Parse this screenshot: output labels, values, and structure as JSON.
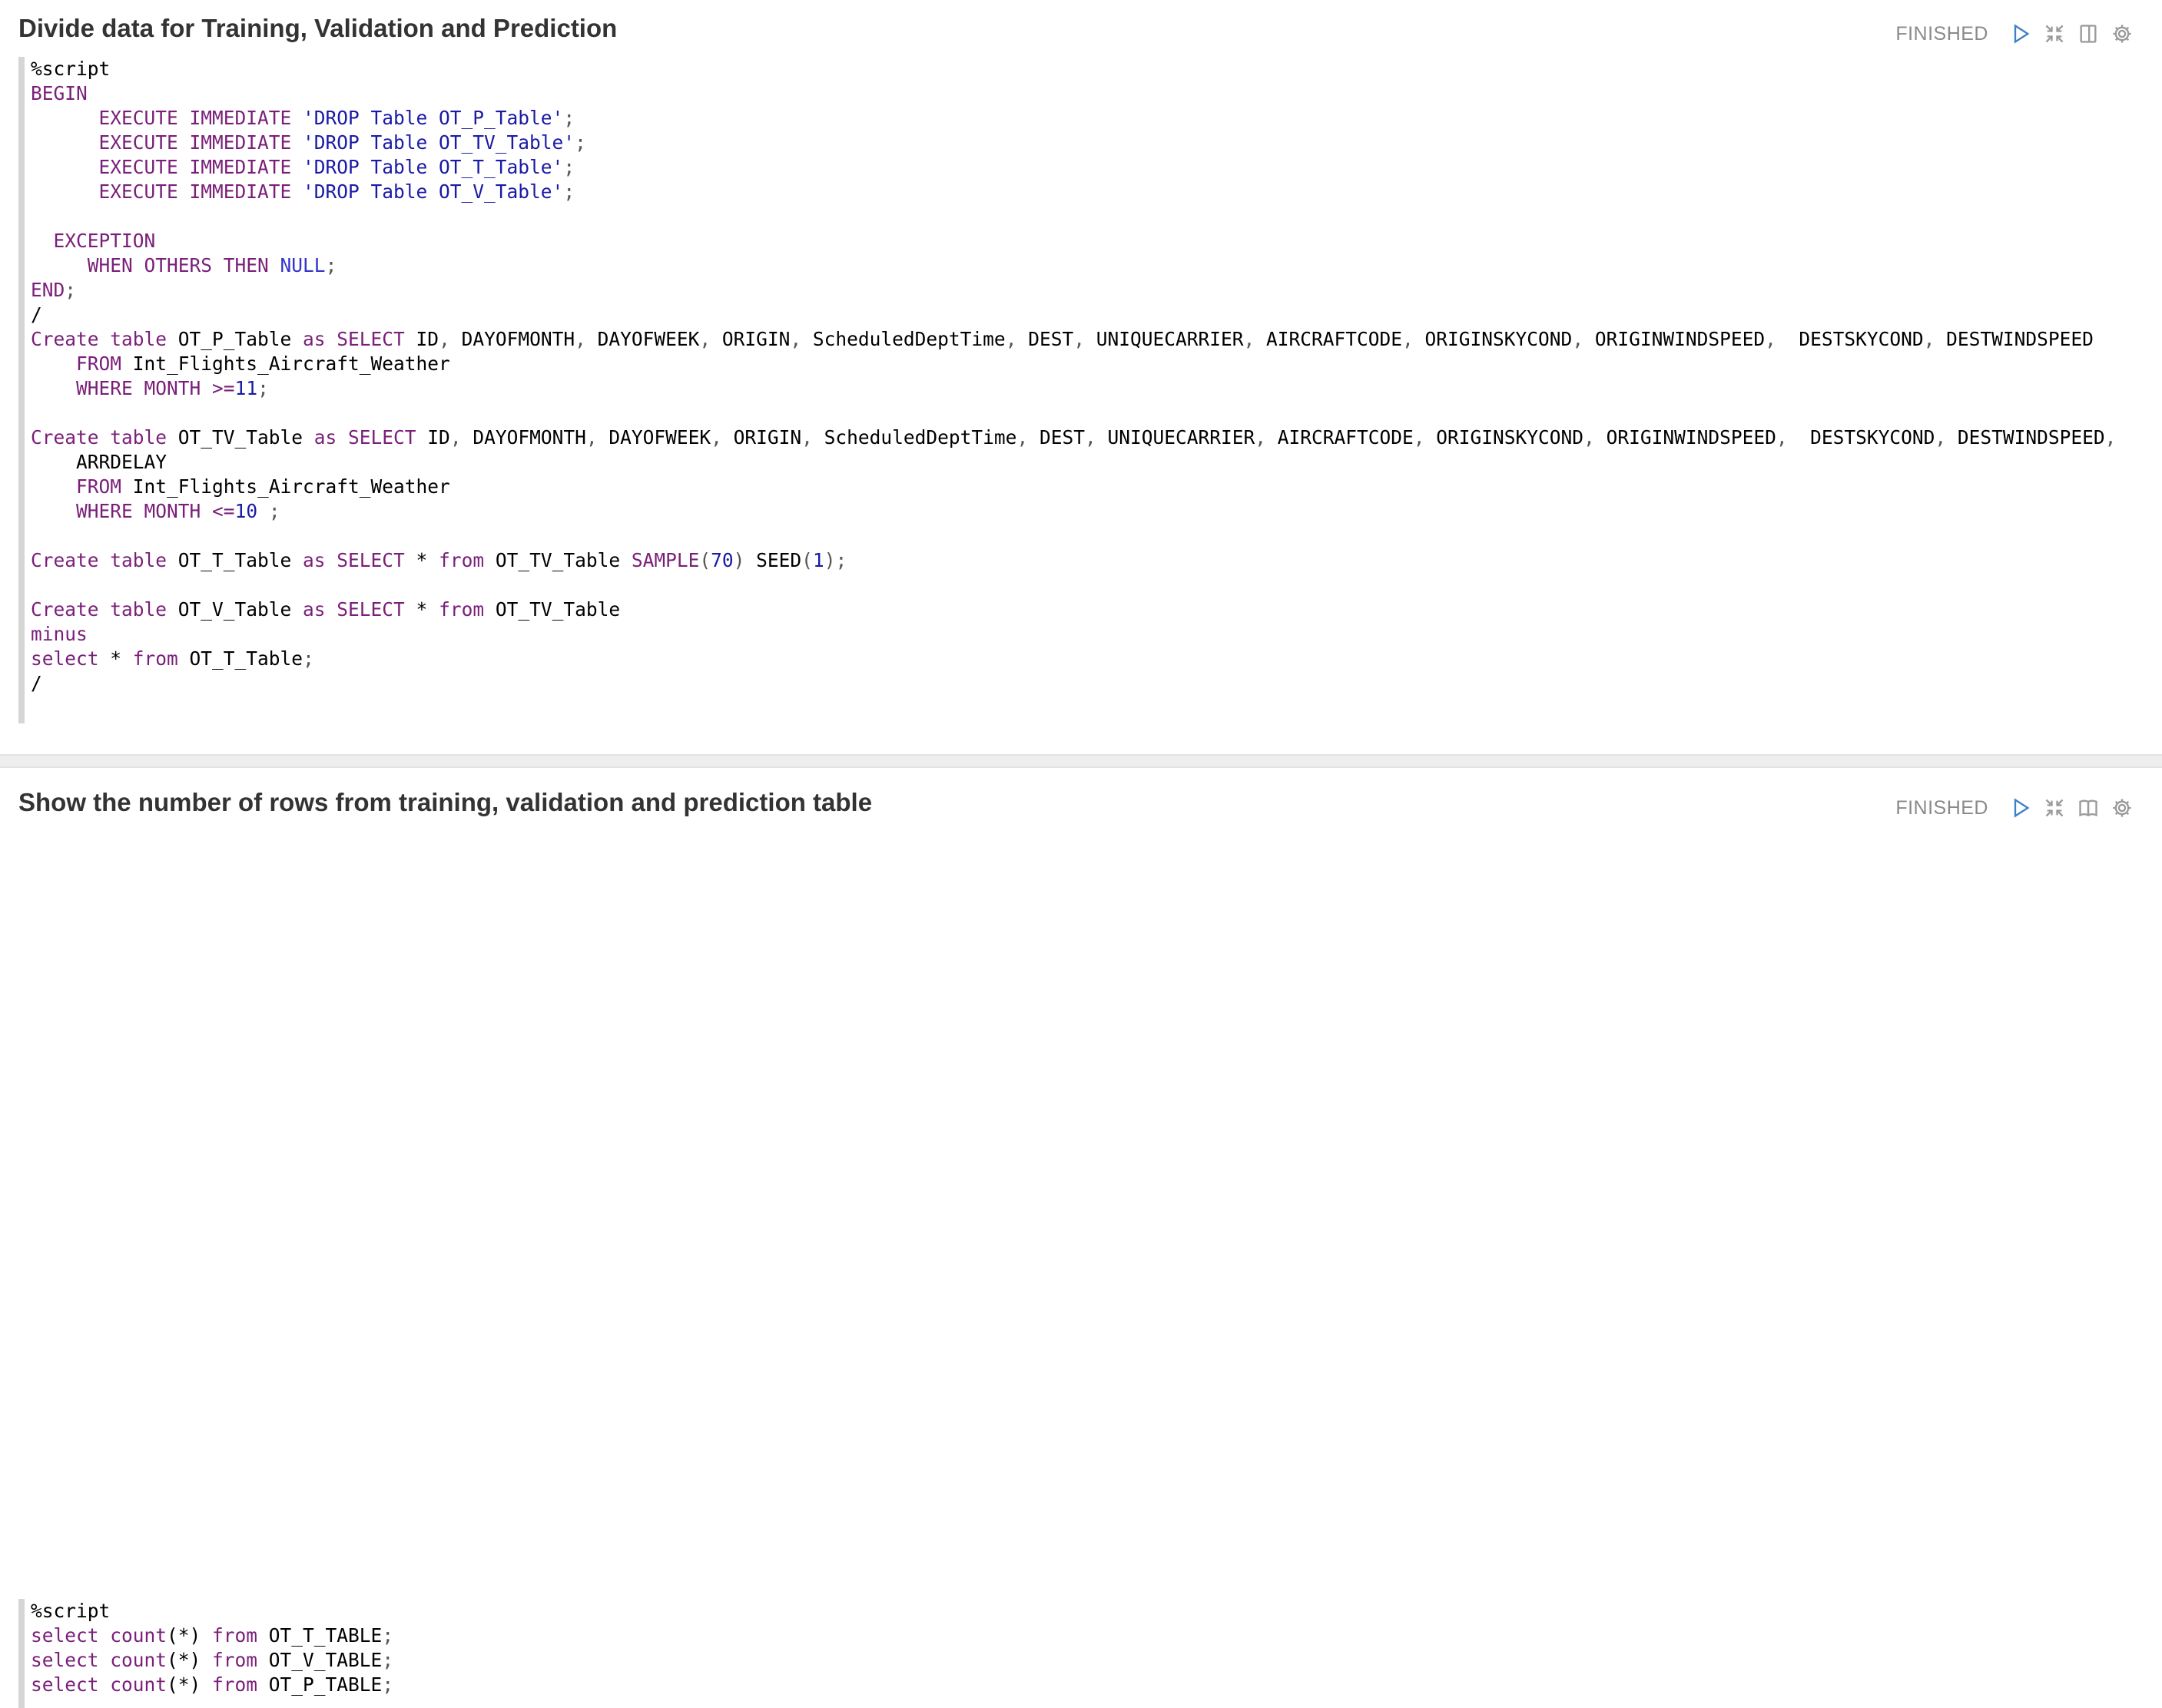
{
  "paragraphs": [
    {
      "title": "Divide data for Training, Validation and Prediction",
      "status": "FINISHED",
      "code": [
        [
          [
            "t",
            "%script"
          ]
        ],
        [
          [
            "k",
            "BEGIN"
          ]
        ],
        [
          [
            "t",
            "      "
          ],
          [
            "k",
            "EXECUTE IMMEDIATE"
          ],
          [
            "t",
            " "
          ],
          [
            "s",
            "'DROP Table OT_P_Table'"
          ],
          [
            "p",
            ";"
          ]
        ],
        [
          [
            "t",
            "      "
          ],
          [
            "k",
            "EXECUTE IMMEDIATE"
          ],
          [
            "t",
            " "
          ],
          [
            "s",
            "'DROP Table OT_TV_Table'"
          ],
          [
            "p",
            ";"
          ]
        ],
        [
          [
            "t",
            "      "
          ],
          [
            "k",
            "EXECUTE IMMEDIATE"
          ],
          [
            "t",
            " "
          ],
          [
            "s",
            "'DROP Table OT_T_Table'"
          ],
          [
            "p",
            ";"
          ]
        ],
        [
          [
            "t",
            "      "
          ],
          [
            "k",
            "EXECUTE IMMEDIATE"
          ],
          [
            "t",
            " "
          ],
          [
            "s",
            "'DROP Table OT_V_Table'"
          ],
          [
            "p",
            ";"
          ]
        ],
        [
          [
            "t",
            ""
          ]
        ],
        [
          [
            "t",
            "  "
          ],
          [
            "k",
            "EXCEPTION"
          ]
        ],
        [
          [
            "t",
            "     "
          ],
          [
            "k",
            "WHEN OTHERS THEN"
          ],
          [
            "t",
            " "
          ],
          [
            "n",
            "NULL"
          ],
          [
            "p",
            ";"
          ]
        ],
        [
          [
            "k",
            "END"
          ],
          [
            "p",
            ";"
          ]
        ],
        [
          [
            "t",
            "/"
          ]
        ],
        [
          [
            "k",
            "Create table"
          ],
          [
            "t",
            " OT_P_Table "
          ],
          [
            "k",
            "as SELECT"
          ],
          [
            "t",
            " ID"
          ],
          [
            "p",
            ","
          ],
          [
            "t",
            " DAYOFMONTH"
          ],
          [
            "p",
            ","
          ],
          [
            "t",
            " DAYOFWEEK"
          ],
          [
            "p",
            ","
          ],
          [
            "t",
            " ORIGIN"
          ],
          [
            "p",
            ","
          ],
          [
            "t",
            " ScheduledDeptTime"
          ],
          [
            "p",
            ","
          ],
          [
            "t",
            " DEST"
          ],
          [
            "p",
            ","
          ],
          [
            "t",
            " UNIQUECARRIER"
          ],
          [
            "p",
            ","
          ],
          [
            "t",
            " AIRCRAFTCODE"
          ],
          [
            "p",
            ","
          ],
          [
            "t",
            " ORIGINSKYCOND"
          ],
          [
            "p",
            ","
          ],
          [
            "t",
            " ORIGINWINDSPEED"
          ],
          [
            "p",
            ","
          ],
          [
            "t",
            "  DESTSKYCOND"
          ],
          [
            "p",
            ","
          ],
          [
            "t",
            " DESTWINDSPEED"
          ]
        ],
        [
          [
            "t",
            "    "
          ],
          [
            "k",
            "FROM"
          ],
          [
            "t",
            " Int_Flights_Aircraft_Weather"
          ]
        ],
        [
          [
            "t",
            "    "
          ],
          [
            "k",
            "WHERE MONTH"
          ],
          [
            "t",
            " "
          ],
          [
            "o",
            ">="
          ],
          [
            "d",
            "11"
          ],
          [
            "p",
            ";"
          ]
        ],
        [
          [
            "t",
            ""
          ]
        ],
        [
          [
            "k",
            "Create table"
          ],
          [
            "t",
            " OT_TV_Table "
          ],
          [
            "k",
            "as SELECT"
          ],
          [
            "t",
            " ID"
          ],
          [
            "p",
            ","
          ],
          [
            "t",
            " DAYOFMONTH"
          ],
          [
            "p",
            ","
          ],
          [
            "t",
            " DAYOFWEEK"
          ],
          [
            "p",
            ","
          ],
          [
            "t",
            " ORIGIN"
          ],
          [
            "p",
            ","
          ],
          [
            "t",
            " ScheduledDeptTime"
          ],
          [
            "p",
            ","
          ],
          [
            "t",
            " DEST"
          ],
          [
            "p",
            ","
          ],
          [
            "t",
            " UNIQUECARRIER"
          ],
          [
            "p",
            ","
          ],
          [
            "t",
            " AIRCRAFTCODE"
          ],
          [
            "p",
            ","
          ],
          [
            "t",
            " ORIGINSKYCOND"
          ],
          [
            "p",
            ","
          ],
          [
            "t",
            " ORIGINWINDSPEED"
          ],
          [
            "p",
            ","
          ],
          [
            "t",
            "  DESTSKYCOND"
          ],
          [
            "p",
            ","
          ],
          [
            "t",
            " DESTWINDSPEED"
          ],
          [
            "p",
            ","
          ]
        ],
        [
          [
            "t",
            "    ARRDELAY"
          ]
        ],
        [
          [
            "t",
            "    "
          ],
          [
            "k",
            "FROM"
          ],
          [
            "t",
            " Int_Flights_Aircraft_Weather"
          ]
        ],
        [
          [
            "t",
            "    "
          ],
          [
            "k",
            "WHERE MONTH"
          ],
          [
            "t",
            " "
          ],
          [
            "o",
            "<="
          ],
          [
            "d",
            "10"
          ],
          [
            "t",
            " "
          ],
          [
            "p",
            ";"
          ]
        ],
        [
          [
            "t",
            ""
          ]
        ],
        [
          [
            "k",
            "Create table"
          ],
          [
            "t",
            " OT_T_Table "
          ],
          [
            "k",
            "as SELECT"
          ],
          [
            "t",
            " * "
          ],
          [
            "k",
            "from"
          ],
          [
            "t",
            " OT_TV_Table "
          ],
          [
            "k",
            "SAMPLE"
          ],
          [
            "p",
            "("
          ],
          [
            "d",
            "70"
          ],
          [
            "p",
            ")"
          ],
          [
            "t",
            " SEED"
          ],
          [
            "p",
            "("
          ],
          [
            "d",
            "1"
          ],
          [
            "p",
            ")"
          ],
          [
            "p",
            ";"
          ]
        ],
        [
          [
            "t",
            ""
          ]
        ],
        [
          [
            "k",
            "Create table"
          ],
          [
            "t",
            " OT_V_Table "
          ],
          [
            "k",
            "as SELECT"
          ],
          [
            "t",
            " * "
          ],
          [
            "k",
            "from"
          ],
          [
            "t",
            " OT_TV_Table"
          ]
        ],
        [
          [
            "k",
            "minus"
          ]
        ],
        [
          [
            "k",
            "select"
          ],
          [
            "t",
            " * "
          ],
          [
            "k",
            "from"
          ],
          [
            "t",
            " OT_T_Table"
          ],
          [
            "p",
            ";"
          ]
        ],
        [
          [
            "t",
            "/"
          ]
        ]
      ]
    },
    {
      "title": "Show the number of rows from training, validation and prediction table",
      "status": "FINISHED",
      "code": [
        [
          [
            "t",
            "%script"
          ]
        ],
        [
          [
            "k",
            "select count"
          ],
          [
            "t",
            "(*) "
          ],
          [
            "k",
            "from"
          ],
          [
            "t",
            " OT_T_TABLE"
          ],
          [
            "p",
            ";"
          ]
        ],
        [
          [
            "k",
            "select count"
          ],
          [
            "t",
            "(*) "
          ],
          [
            "k",
            "from"
          ],
          [
            "t",
            " OT_V_TABLE"
          ],
          [
            "p",
            ";"
          ]
        ],
        [
          [
            "k",
            "select count"
          ],
          [
            "t",
            "(*) "
          ],
          [
            "k",
            "from"
          ],
          [
            "t",
            " OT_P_TABLE"
          ],
          [
            "p",
            ";"
          ]
        ]
      ]
    }
  ],
  "icons": {
    "run": "play-icon",
    "hide_editor": "collapse-icon",
    "hide_output": "layout-icon",
    "settings": "gear-icon"
  },
  "colors": {
    "keyword": "#7a1f79",
    "string": "#1a1aa6",
    "number": "#1a1aa6",
    "run_icon": "#3d7fc4",
    "muted_icon": "#9a9a9a"
  }
}
